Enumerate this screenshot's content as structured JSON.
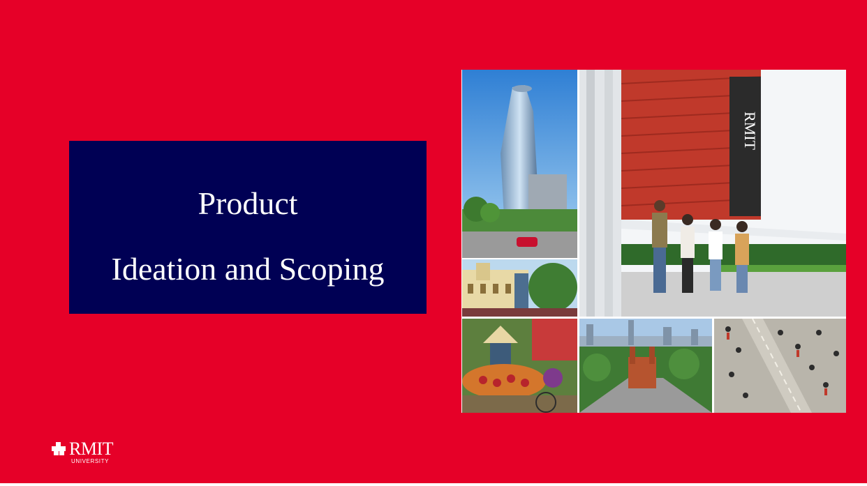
{
  "slide": {
    "background_color": "#e60028",
    "title_box_color": "#000054"
  },
  "title": {
    "line1": "Product",
    "line2": "Ideation and Scoping"
  },
  "collage": {
    "building_sign": "RMIT"
  },
  "logo": {
    "wordmark": "RMIT",
    "subtitle": "UNIVERSITY"
  }
}
